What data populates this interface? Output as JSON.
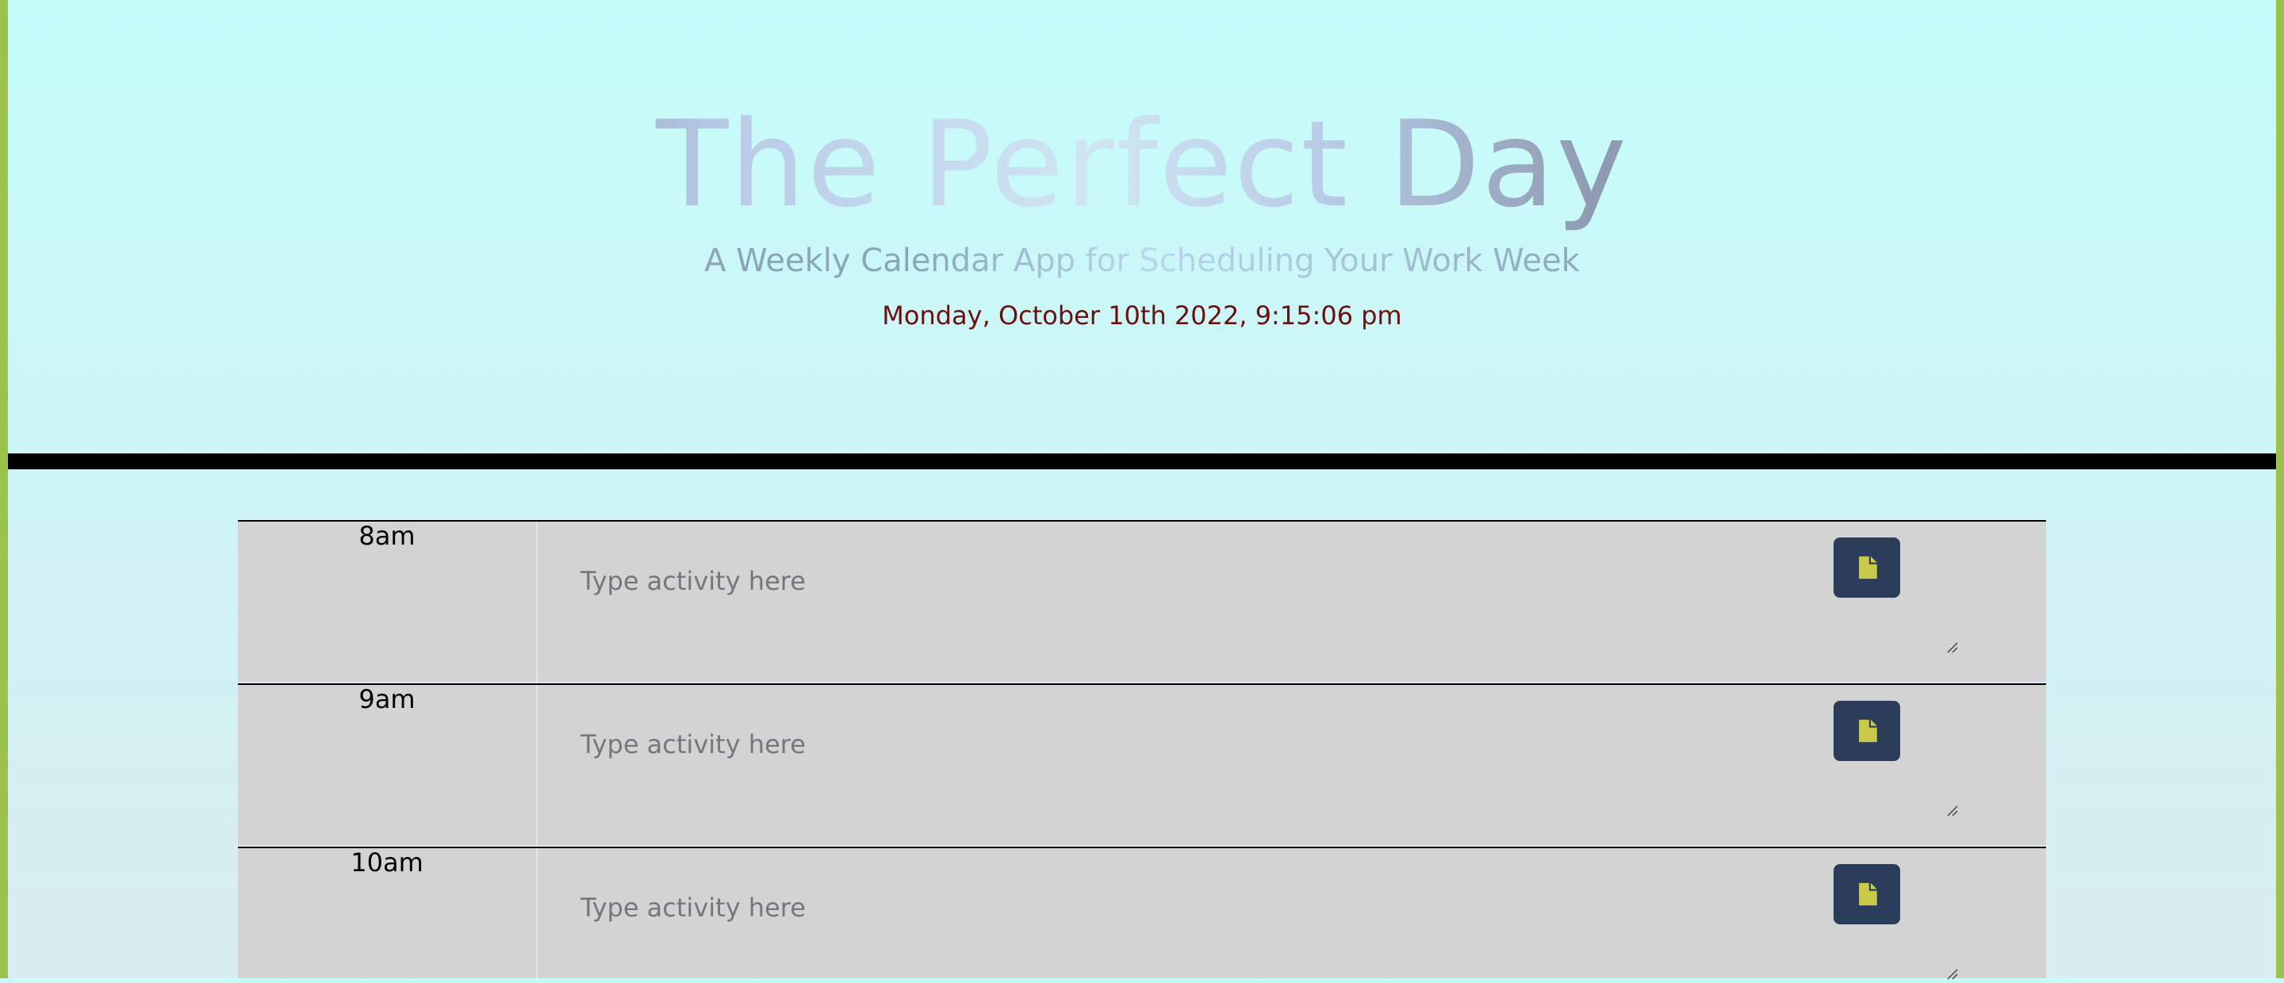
{
  "header": {
    "title_words": [
      "The",
      "Perfect",
      "Day"
    ],
    "subtitle": "A Weekly Calendar App for Scheduling Your Work Week",
    "current_date": "Monday, October 10th 2022, 9:15:06 pm"
  },
  "schedule": {
    "placeholder": "Type activity here",
    "save_icon": "file-icon",
    "blocks": [
      {
        "hour": "8am",
        "text": ""
      },
      {
        "hour": "9am",
        "text": ""
      },
      {
        "hour": "10am",
        "text": ""
      }
    ]
  },
  "colors": {
    "side_border": "#9bc24a",
    "block_background": "#d3d3d3",
    "save_button": "#2c3d5c",
    "save_icon": "#c9c94a",
    "date_text": "#6b0f0f"
  }
}
